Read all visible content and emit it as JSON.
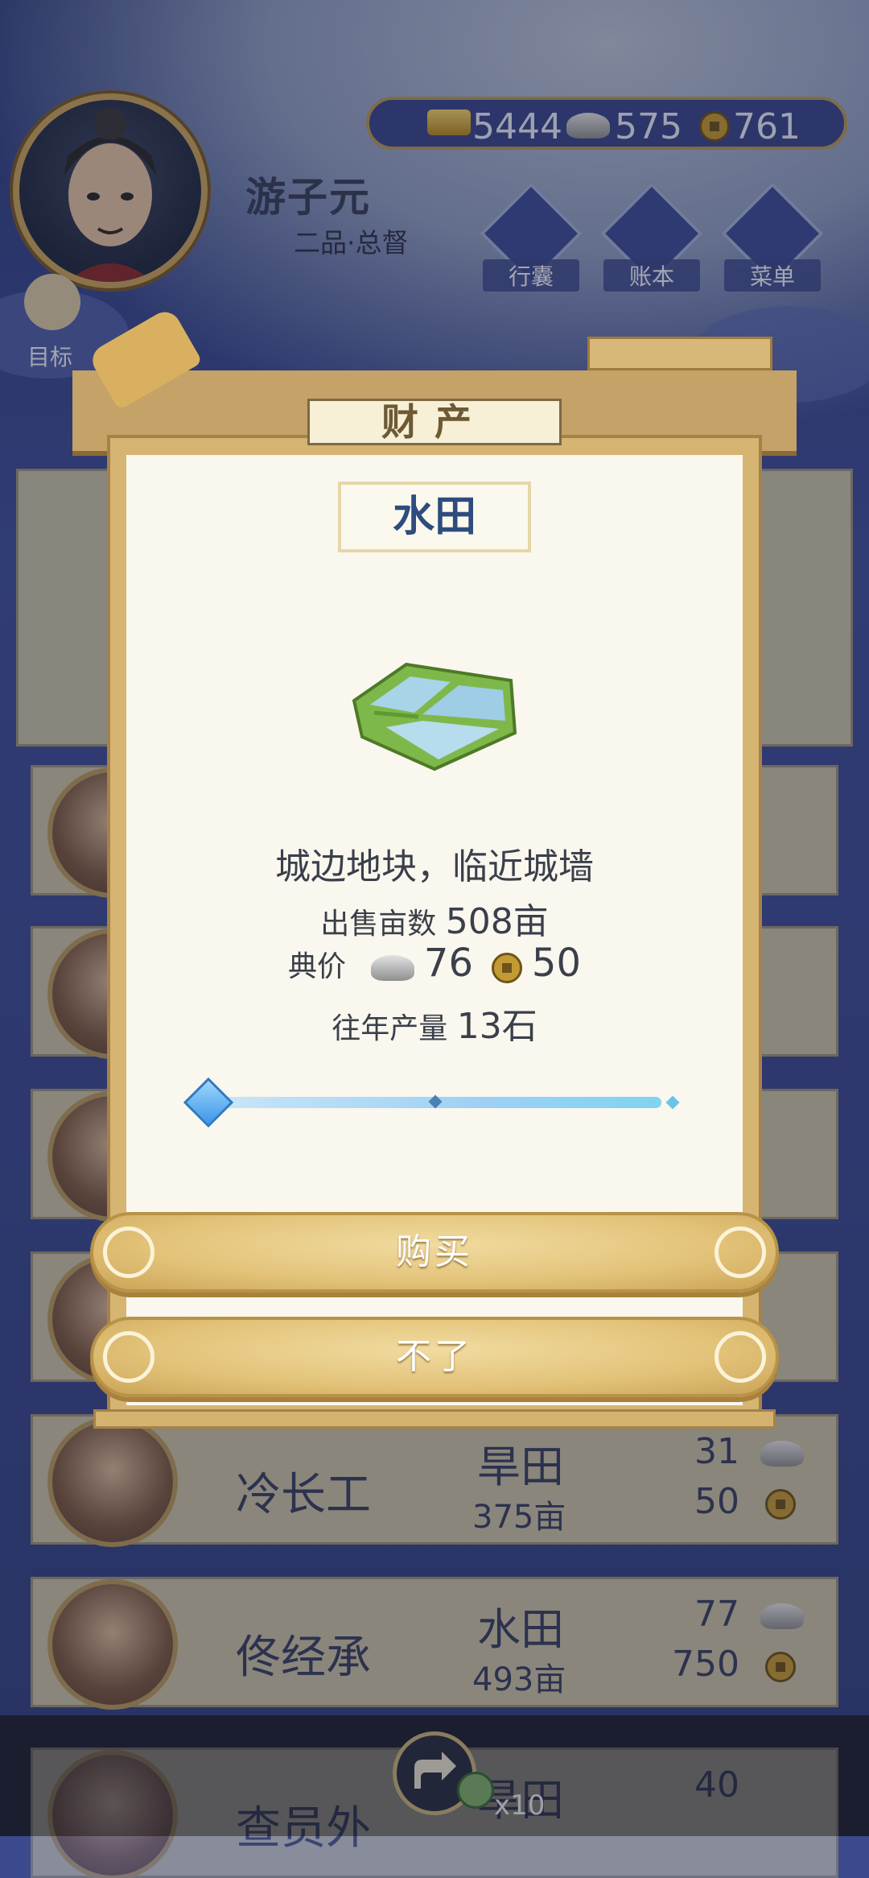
{
  "header": {
    "player_name": "游子元",
    "player_rank": "二品·总督",
    "currency": {
      "gold": "5444",
      "silver": "575",
      "copper": "761"
    },
    "menu": [
      {
        "label": "行囊",
        "icon": "bag-icon"
      },
      {
        "label": "账本",
        "icon": "ledger-icon"
      },
      {
        "label": "菜单",
        "icon": "menu-dots-icon"
      }
    ],
    "goal_label": "目标"
  },
  "rows": [
    {
      "name": "冷长工",
      "type": "旱田",
      "area": "375亩",
      "silver": "31",
      "copper": "50"
    },
    {
      "name": "佟经承",
      "type": "水田",
      "area": "493亩",
      "silver": "77",
      "copper": "750"
    },
    {
      "name": "查员外",
      "type": "旱田",
      "silver": "40"
    }
  ],
  "modal": {
    "title": "财产",
    "item_name": "水田",
    "description": "城边地块，临近城墙",
    "qty_label": "出售亩数",
    "qty_value": "508亩",
    "price_label": "典价",
    "price_silver": "76",
    "price_copper": "50",
    "yield_label": "往年产量",
    "yield_value": "13石",
    "slider_value": 0.0,
    "buy_label": "购买",
    "cancel_label": "不了"
  },
  "bottom": {
    "multiplier": "x10"
  },
  "colors": {
    "accent_gold": "#e2c278",
    "title_blue": "#2e4c7d",
    "background": "#3b4a8c"
  }
}
